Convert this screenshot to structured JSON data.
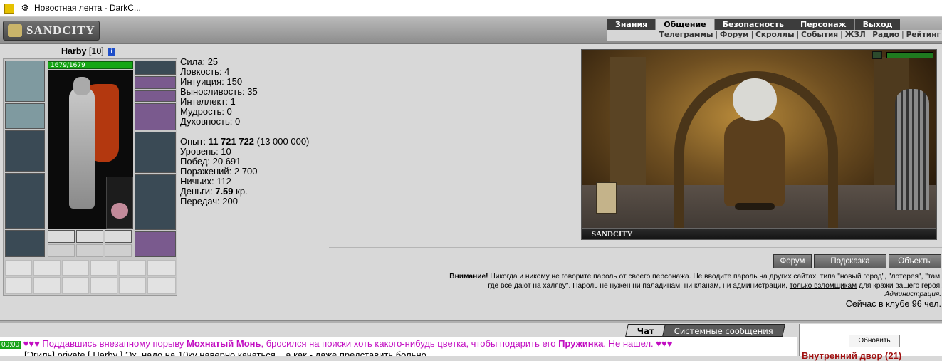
{
  "browser": {
    "tab_title": "Новостная лента - DarkC..."
  },
  "header": {
    "logo": "SANDCITY",
    "main_menu": [
      "Знания",
      "Общение",
      "Безопасность",
      "Персонаж",
      "Выход"
    ],
    "active_menu": "Общение",
    "sub_menu": [
      "Телеграммы",
      "Форум",
      "Скроллы",
      "События",
      "ЖЗЛ",
      "Радио",
      "Рейтинг"
    ]
  },
  "character": {
    "name": "Harby",
    "level": "[10]",
    "hp": "1679/1679",
    "hp_fraction": 1.0
  },
  "stats": {
    "strength": "Сила: 25",
    "agility": "Ловкость: 4",
    "intuition": "Интуиция: 150",
    "endurance": "Выносливость: 35",
    "intellect": "Интеллект: 1",
    "wisdom": "Мудрость: 0",
    "spirituality": "Духовность: 0",
    "exp_label": "Опыт: ",
    "exp_value": "11 721 722",
    "exp_next": " (13 000 000)",
    "level": "Уровень: 10",
    "wins": "Побед: 20 691",
    "losses": "Поражений: 2 700",
    "draws": "Ничьих: 112",
    "money_label": "Деньги: ",
    "money_value": "7.59",
    "money_unit": " кр.",
    "transfers": "Передач: 200"
  },
  "scene": {
    "caption": "SANDCITY"
  },
  "buttons": {
    "forum": "Форум",
    "hint": "Подсказка",
    "objects": "Объекты"
  },
  "warning": {
    "label": "Внимание!",
    "text1": " Никогда и никому не говорите пароль от своего персонажа. Не вводите пароль на других сайтах, типа \"новый город\", \"лотерея\", \"там,",
    "text2": "где все дают на халяву\". Пароль не нужен ни паладинам, ни кланам, ни администрации, ",
    "link": "только взломщикам",
    "text3": " для кражи вашего героя.",
    "signature": "Администрация."
  },
  "online": "Сейчас в клубе 96 чел.",
  "chat": {
    "tabs": [
      "Чат",
      "Системные сообщения"
    ],
    "line1_time": "00:00",
    "line1_hearts": "♥♥♥",
    "line1_text_a": " Поддавшись внезапному порыву ",
    "line1_nick_a": "Мохнатый Монь",
    "line1_text_b": ", бросился на поиски хоть какого-нибудь цветка, чтобы подарить его ",
    "line1_nick_b": "Пружинка",
    "line1_text_c": ". Не нашел. ",
    "line1_hearts_end": "♥♥♥",
    "line2": "[Эгиль] private [ Harby ] Эх, надо на 10ку наверно качаться... а как - даже представить больно...",
    "refresh": "Обновить",
    "room": "Внутренний двор (21)"
  }
}
